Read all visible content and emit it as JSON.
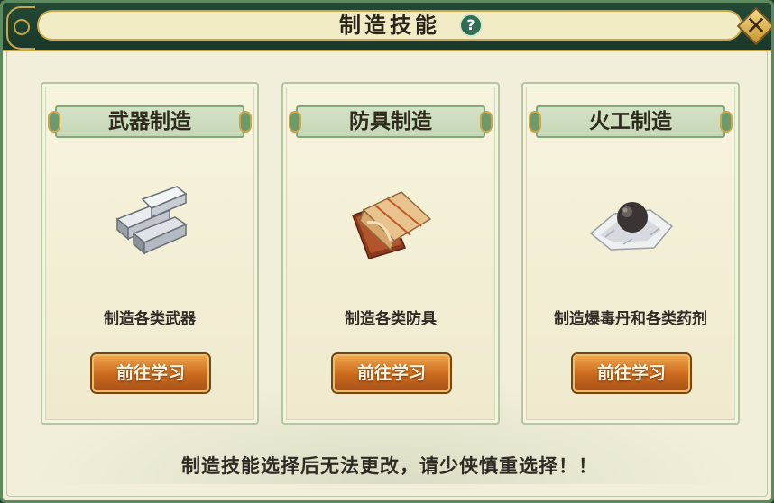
{
  "window": {
    "title": "制造技能",
    "help_icon": "question-mark-icon",
    "close_icon": "close-x-icon"
  },
  "cards": [
    {
      "title": "武器制造",
      "icon": "silver-ingots-icon",
      "description": "制造各类武器",
      "button_label": "前往学习"
    },
    {
      "title": "防具制造",
      "icon": "cloth-bundle-icon",
      "description": "制造各类防具",
      "button_label": "前往学习"
    },
    {
      "title": "火工制造",
      "icon": "black-ball-on-paper-icon",
      "description": "制造爆毒丹和各类药剂",
      "button_label": "前往学习"
    }
  ],
  "notice": "制造技能选择后无法更改，请少侠慎重选择！！",
  "colors": {
    "frame_green": "#1e3a28",
    "gold_trim": "#c9a74a",
    "panel_bg": "#f1efd9",
    "button_orange": "#c9691c"
  }
}
